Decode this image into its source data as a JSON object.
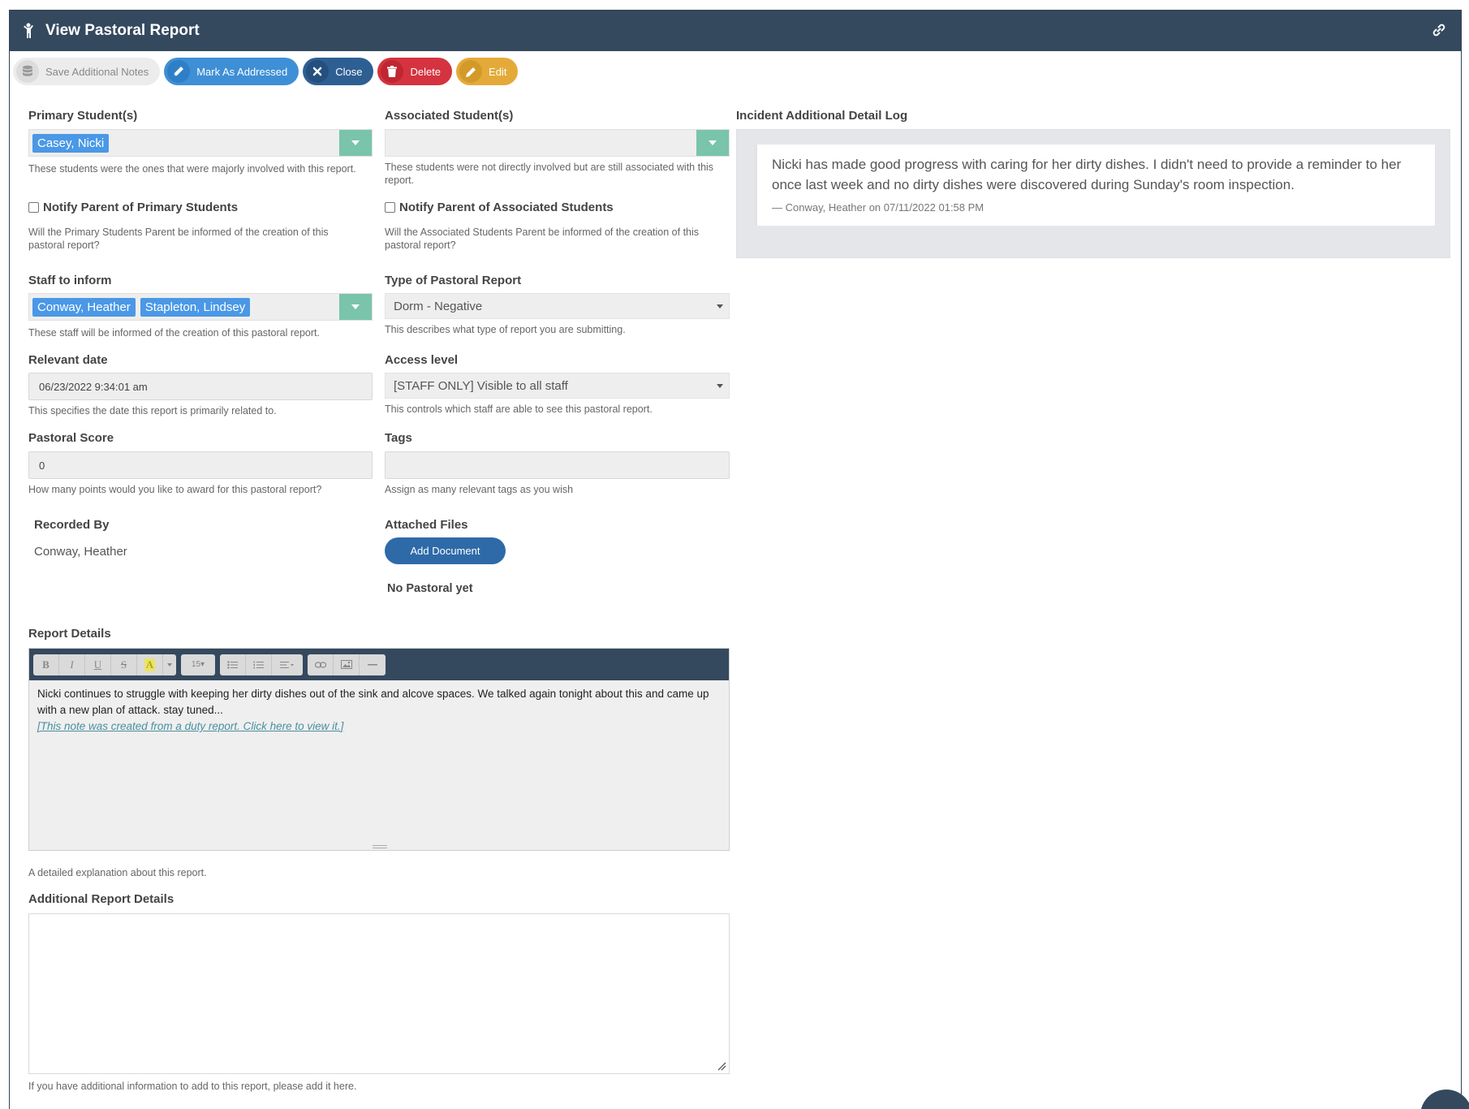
{
  "header": {
    "title": "View Pastoral Report"
  },
  "toolbar": {
    "save_notes": "Save Additional Notes",
    "mark_addressed": "Mark As Addressed",
    "close": "Close",
    "delete": "Delete",
    "edit": "Edit"
  },
  "primary_students": {
    "label": "Primary Student(s)",
    "tags": [
      "Casey, Nicki"
    ],
    "help": "These students were the ones that were majorly involved with this report."
  },
  "associated_students": {
    "label": "Associated Student(s)",
    "help": "These students were not directly involved but are still associated with this report."
  },
  "notify_primary": {
    "label": "Notify Parent of Primary Students",
    "help": "Will the Primary Students Parent be informed of the creation of this pastoral report?"
  },
  "notify_associated": {
    "label": "Notify Parent of Associated Students",
    "help": "Will the Associated Students Parent be informed of the creation of this pastoral report?"
  },
  "staff_to_inform": {
    "label": "Staff to inform",
    "tags": [
      "Conway, Heather",
      "Stapleton, Lindsey"
    ],
    "help": "These staff will be informed of the creation of this pastoral report."
  },
  "report_type": {
    "label": "Type of Pastoral Report",
    "value": "Dorm - Negative",
    "help": "This describes what type of report you are submitting."
  },
  "relevant_date": {
    "label": "Relevant date",
    "value": "06/23/2022 9:34:01 am",
    "help": "This specifies the date this report is primarily related to."
  },
  "access_level": {
    "label": "Access level",
    "value": "[STAFF ONLY] Visible to all staff",
    "help": "This controls which staff are able to see this pastoral report."
  },
  "pastoral_score": {
    "label": "Pastoral Score",
    "value": "0",
    "help": "How many points would you like to award for this pastoral report?"
  },
  "tags_field": {
    "label": "Tags",
    "value": "",
    "help": "Assign as many relevant tags as you wish"
  },
  "recorded_by": {
    "label": "Recorded By",
    "value": "Conway, Heather"
  },
  "attached_files": {
    "label": "Attached Files",
    "button": "Add Document",
    "empty": "No Pastoral yet"
  },
  "detail_log": {
    "label": "Incident Additional Detail Log",
    "entries": [
      {
        "note": "Nicki has made good progress with caring for her dirty dishes. I didn't need to provide a reminder to her once last week and no dirty dishes were discovered during Sunday's room inspection.",
        "by": "— Conway, Heather on 07/11/2022 01:58 PM"
      }
    ]
  },
  "report_details": {
    "label": "Report Details",
    "font_size": "15",
    "body": "Nicki continues to struggle with keeping her dirty dishes out of the sink and alcove spaces. We talked again tonight about this and came up with a new plan of attack. stay tuned...",
    "link": "[This note was created from a duty report. Click here to view it.]",
    "help": "A detailed explanation about this report."
  },
  "additional_details": {
    "label": "Additional Report Details",
    "value": "",
    "help": "If you have additional information to add to this report, please add it here."
  }
}
